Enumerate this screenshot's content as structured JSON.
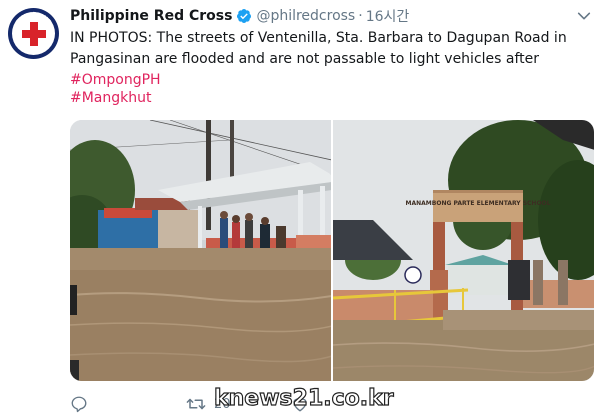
{
  "account": {
    "display_name": "Philippine Red Cross",
    "handle": "@philredcross",
    "separator": "·",
    "time": "16시간",
    "avatar_ring_text": "PHILIPPINE RED CROSS",
    "verified": true
  },
  "tweet": {
    "text_line1": "IN PHOTOS: The streets of Ventenilla, Sta. Barbara to Dagupan Road in",
    "text_line2_prefix": "Pangasinan are flooded and are not passable to light vehicles after ",
    "hashtag_inline": "#OmpongPH",
    "hashtag_second": "#Mangkhut"
  },
  "media": {
    "photo_left": "flooded-street-with-waiting-shed",
    "photo_right": "flooded-school-gate",
    "school_sign_text": "MANAMBONG PARTE ELEMENTARY SCHOOL"
  },
  "actions": {
    "reply_count": "",
    "retweet_count": "20",
    "like_count": ""
  },
  "watermark": "knews21.co.kr",
  "colors": {
    "hashtag": "#e0245e",
    "verified": "#1da1f2",
    "muted": "#657786",
    "red_cross": "#d8232a",
    "avatar_ring": "#14296b"
  },
  "icons": [
    "verified-icon",
    "chevron-down-icon",
    "reply-icon",
    "retweet-icon",
    "like-icon"
  ]
}
